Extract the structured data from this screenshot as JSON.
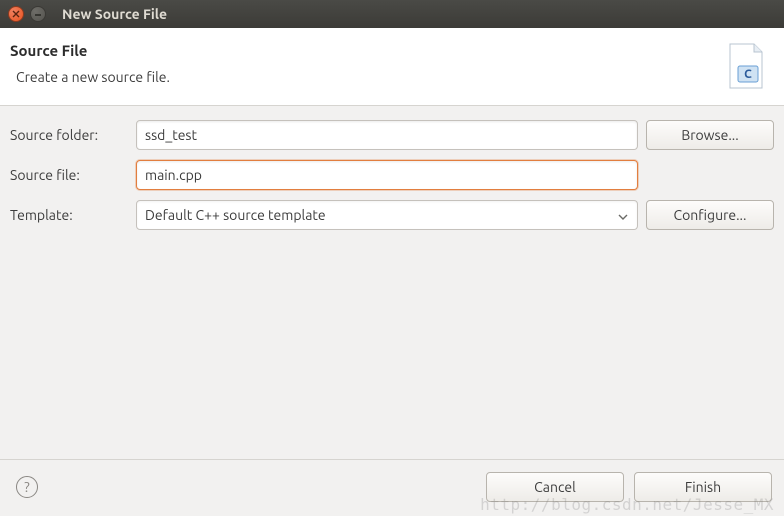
{
  "window": {
    "title": "New Source File"
  },
  "header": {
    "title": "Source File",
    "subtitle": "Create a new source file."
  },
  "form": {
    "source_folder": {
      "label": "Source folder:",
      "value": "ssd_test",
      "browse_label": "Browse..."
    },
    "source_file": {
      "label": "Source file:",
      "value": "main.cpp"
    },
    "template": {
      "label": "Template:",
      "selected": "Default C++ source template",
      "configure_label": "Configure..."
    }
  },
  "footer": {
    "cancel_label": "Cancel",
    "finish_label": "Finish"
  },
  "watermark": "http://blog.csdn.net/Jesse_MX"
}
